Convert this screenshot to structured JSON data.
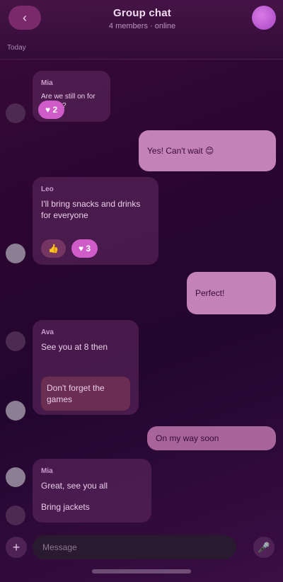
{
  "header": {
    "back_label": "‹",
    "title": "Group chat",
    "subtitle": "4 members · online",
    "section_label": "Today"
  },
  "messages": [
    {
      "sender": "Mia",
      "text": "Are we still on for tonight?",
      "reaction": "♥ 2"
    },
    {
      "text": "Yes! Can't wait 😊"
    },
    {
      "sender": "Leo",
      "text": "I'll bring snacks and drinks for everyone",
      "reactions": [
        "👍",
        "♥ 3"
      ]
    },
    {
      "text": "Perfect!"
    },
    {
      "sender": "Ava",
      "text": "See you at 8 then",
      "text2": "Don't forget the games"
    },
    {
      "text": "On my way soon"
    },
    {
      "sender": "Mia",
      "text": "Great, see you all",
      "text2": "Bring jackets"
    }
  ],
  "composer": {
    "placeholder": "Message",
    "plus": "+",
    "mic": "🎤"
  },
  "colors": {
    "accent": "#cf5cc8",
    "outgoing": "#c383b8",
    "background": "#2a0630"
  }
}
